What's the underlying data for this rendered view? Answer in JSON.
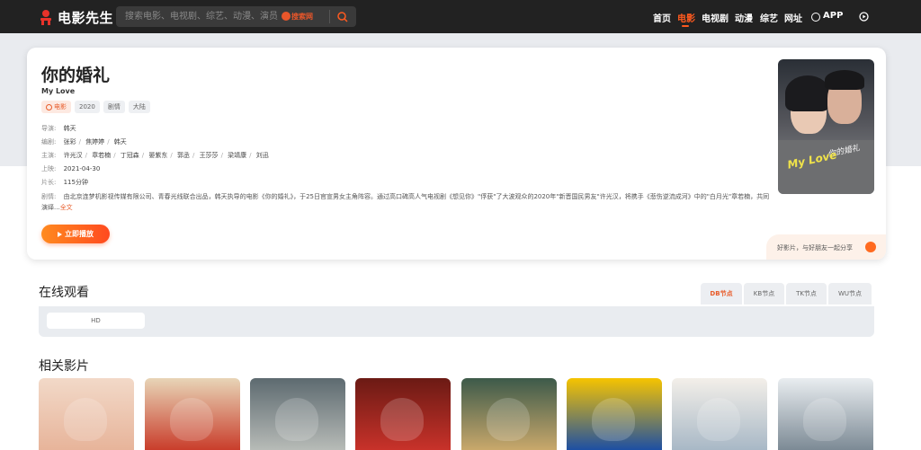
{
  "header": {
    "logo_text": "电影先生",
    "search_placeholder": "搜索电影、电视剧、综艺、动漫、演员",
    "search_brand": "搜索网",
    "nav": [
      {
        "label": "首页",
        "active": false
      },
      {
        "label": "电影",
        "active": true
      },
      {
        "label": "电视剧",
        "active": false
      },
      {
        "label": "动漫",
        "active": false
      },
      {
        "label": "综艺",
        "active": false
      },
      {
        "label": "网址",
        "active": false
      },
      {
        "label": "APP",
        "active": false
      }
    ],
    "accent_color": "#ff5a1f"
  },
  "movie": {
    "title": "你的婚礼",
    "subtitle": "My Love",
    "tags": [
      "电影",
      "2020",
      "剧情",
      "大陆"
    ],
    "director_label": "导演:",
    "director": "韩天",
    "writer_label": "编剧:",
    "writers": [
      "张彩",
      "焦婷婷",
      "韩天"
    ],
    "cast_label": "主演:",
    "cast": [
      "许光汉",
      "章若楠",
      "丁冠森",
      "晏紫东",
      "郭丞",
      "王莎莎",
      "梁靖康",
      "刘迅"
    ],
    "release_label": "上映:",
    "release": "2021-04-30",
    "length_label": "片长:",
    "length": "115分钟",
    "plot_label": "剧情:",
    "plot": "由北京连梦机影视传媒有限公司、青春光线联合出品，韩天执导的电影《你的婚礼》，于25日官宣男女主角阵容。通过高口碑高人气电视剧《想见你》\"俘获\"了大波观众的2020年\"新晋国民男友\"许光汉，将携手《悲伤逆流成河》中的\"白月光\"章若楠，共同演绎...",
    "more_link": "全文",
    "play_label": "立即播放",
    "poster_text": "你的婚礼",
    "poster_text_en": "My Love",
    "share_text": "好影片，与好朋友一起分享"
  },
  "online": {
    "title": "在线观看",
    "sources": [
      {
        "label": "DB节点",
        "active": true
      },
      {
        "label": "KB节点",
        "active": false
      },
      {
        "label": "TK节点",
        "active": false
      },
      {
        "label": "WU节点",
        "active": false
      }
    ],
    "episodes": [
      "HD"
    ]
  },
  "related": {
    "title": "相关影片",
    "items": [
      {
        "colors": [
          "#f2d9c8",
          "#e7b49a"
        ]
      },
      {
        "colors": [
          "#e8d5b7",
          "#c93d2b"
        ]
      },
      {
        "colors": [
          "#5d6a70",
          "#b7bbb7"
        ]
      },
      {
        "colors": [
          "#6b1a14",
          "#c8322a"
        ]
      },
      {
        "colors": [
          "#3d5a4a",
          "#c9a86b"
        ]
      },
      {
        "colors": [
          "#f6c400",
          "#1d4fa3"
        ]
      },
      {
        "colors": [
          "#f3efe9",
          "#a8b8c6"
        ]
      },
      {
        "colors": [
          "#e9edf0",
          "#7c8a95"
        ]
      }
    ]
  }
}
